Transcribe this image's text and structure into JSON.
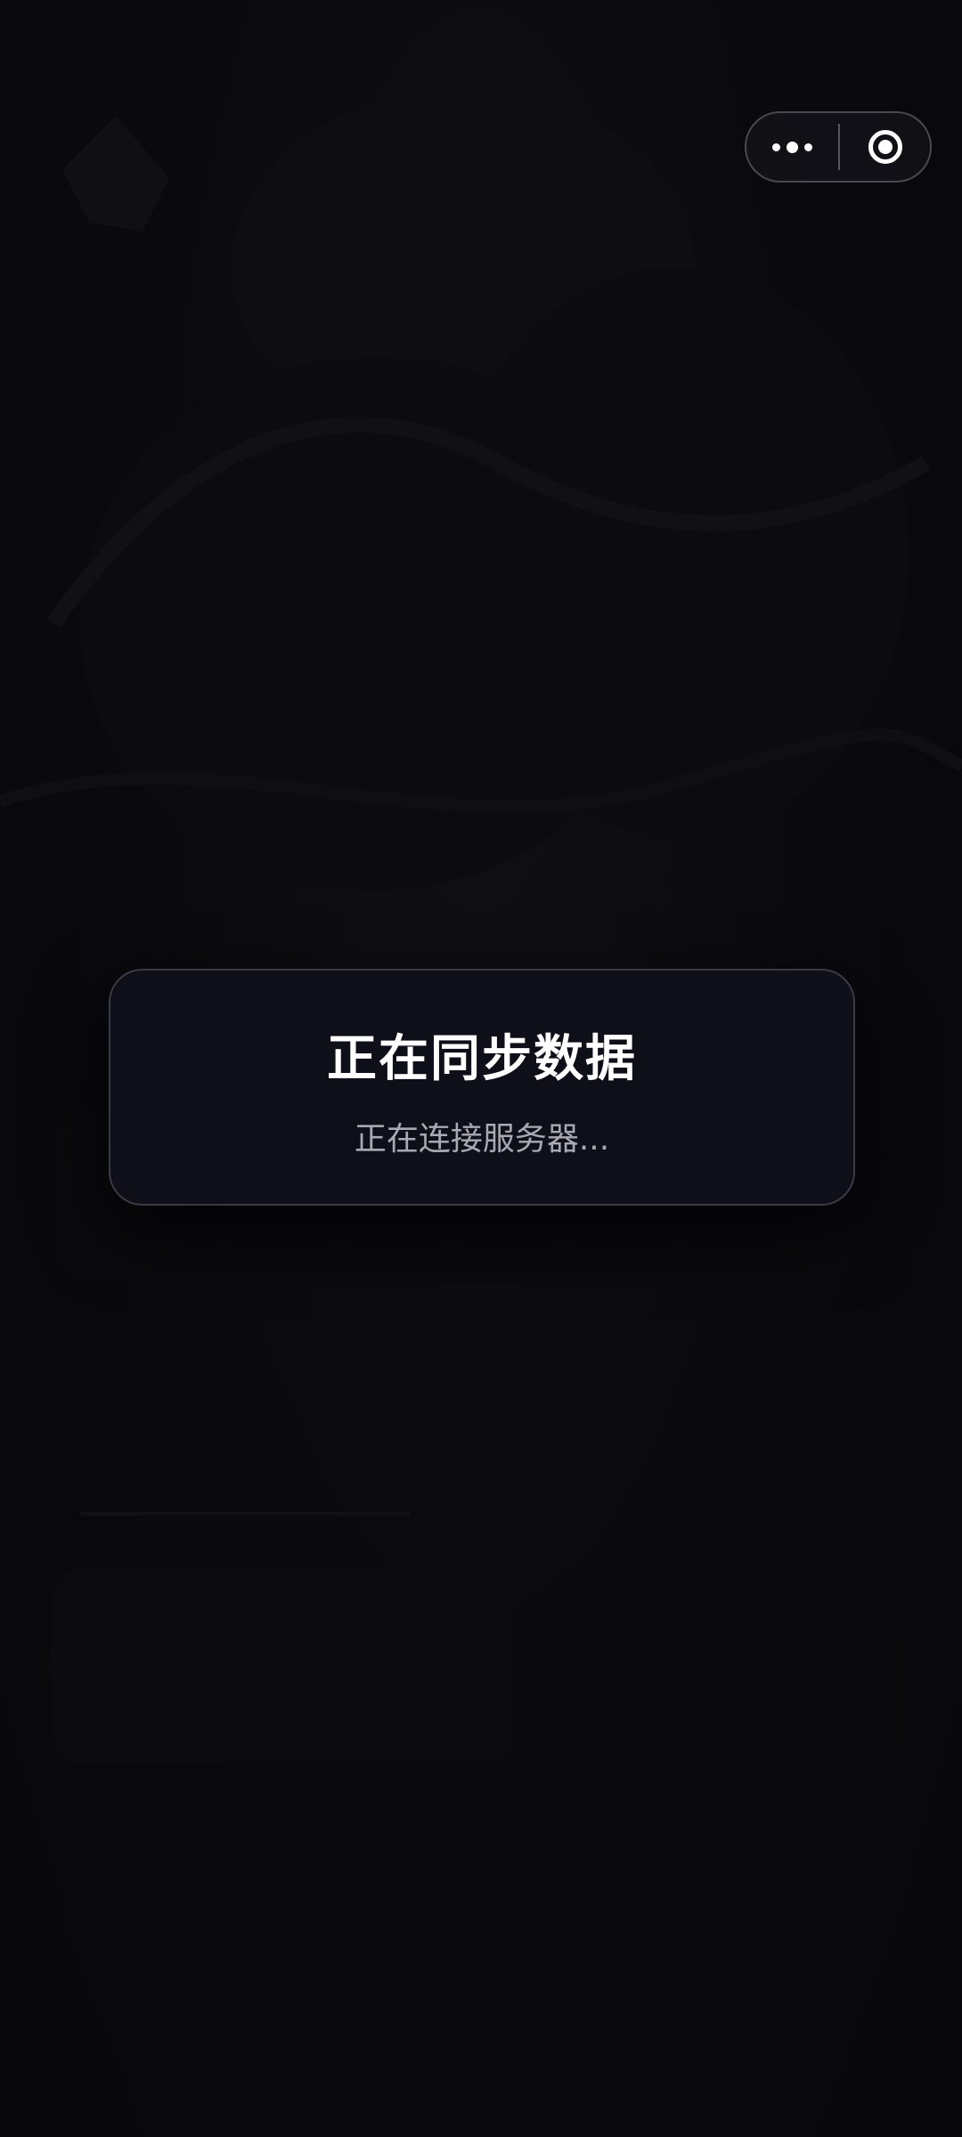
{
  "capsule": {
    "more_icon": "more-dots-icon",
    "close_icon": "target-circle-icon"
  },
  "dialog": {
    "title": "正在同步数据",
    "message": "正在连接服务器..."
  },
  "colors": {
    "background": "#0b0b10",
    "dialog_background": "#0f0f1a",
    "dialog_border": "#3b3b46",
    "title": "#ffffff",
    "message": "#a9a9b3"
  }
}
